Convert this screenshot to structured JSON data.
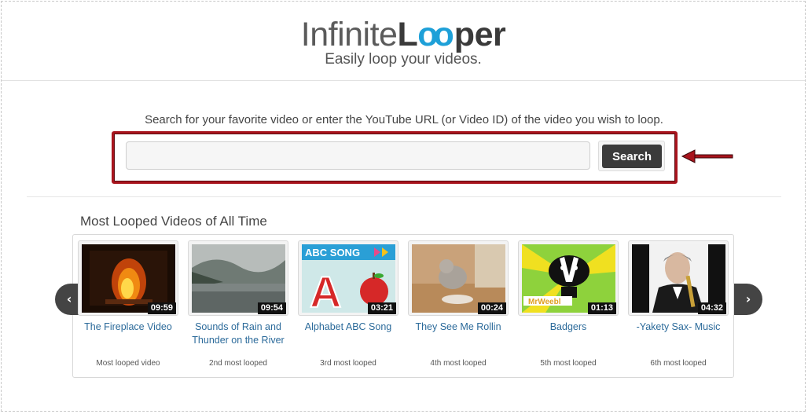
{
  "logo": {
    "part1": "Infinite",
    "part2": "L",
    "part3": "oo",
    "part4": "per"
  },
  "tagline": "Easily loop your videos.",
  "search": {
    "instructions": "Search for your favorite video or enter the YouTube URL (or Video ID) of the video you wish to loop.",
    "value": "",
    "placeholder": "",
    "button_label": "Search"
  },
  "colors": {
    "highlight_border": "#a8141d",
    "accent": "#1ea0d8",
    "link": "#2b6a9a",
    "button": "#3b3b3b"
  },
  "section_title": "Most Looped Videos of All Time",
  "carousel": {
    "prev_icon": "chevron-left-icon",
    "next_icon": "chevron-right-icon",
    "videos": [
      {
        "title": "The Fireplace Video",
        "duration": "09:59",
        "rank": "Most looped video"
      },
      {
        "title": "Sounds of Rain and Thunder on the River",
        "duration": "09:54",
        "rank": "2nd most looped"
      },
      {
        "title": "Alphabet ABC Song",
        "duration": "03:21",
        "rank": "3rd most looped",
        "thumb_text": "ABC SONG"
      },
      {
        "title": "They See Me Rollin",
        "duration": "00:24",
        "rank": "4th most looped"
      },
      {
        "title": "Badgers",
        "duration": "01:13",
        "rank": "5th most looped",
        "thumb_text": "MrWeebl"
      },
      {
        "title": "-Yakety Sax- Music",
        "duration": "04:32",
        "rank": "6th most looped"
      }
    ]
  }
}
